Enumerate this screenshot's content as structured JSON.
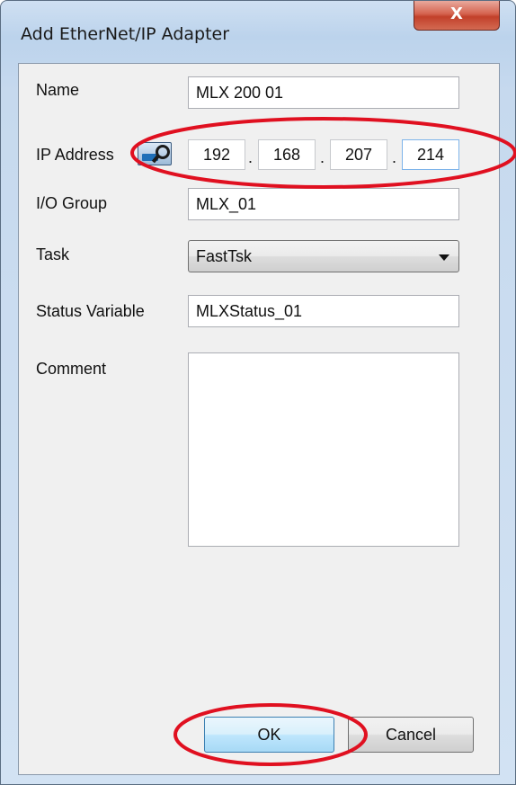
{
  "window": {
    "title": "Add EtherNet/IP Adapter",
    "close_glyph": "X"
  },
  "form": {
    "name": {
      "label": "Name",
      "value": "MLX 200 01"
    },
    "ip": {
      "label": "IP Address",
      "octets": [
        "192",
        "168",
        "207",
        "214"
      ],
      "separator": ".",
      "lookup_icon": "network-lookup-icon"
    },
    "io_group": {
      "label": "I/O Group",
      "value": "MLX_01"
    },
    "task": {
      "label": "Task",
      "selected": "FastTsk"
    },
    "status_variable": {
      "label": "Status Variable",
      "value": "MLXStatus_01"
    },
    "comment": {
      "label": "Comment",
      "value": ""
    }
  },
  "buttons": {
    "ok": "OK",
    "cancel": "Cancel"
  },
  "colors": {
    "annotation_red": "#e01020",
    "close_red": "#c2402a",
    "default_button_blue": "#3c7fb1"
  }
}
